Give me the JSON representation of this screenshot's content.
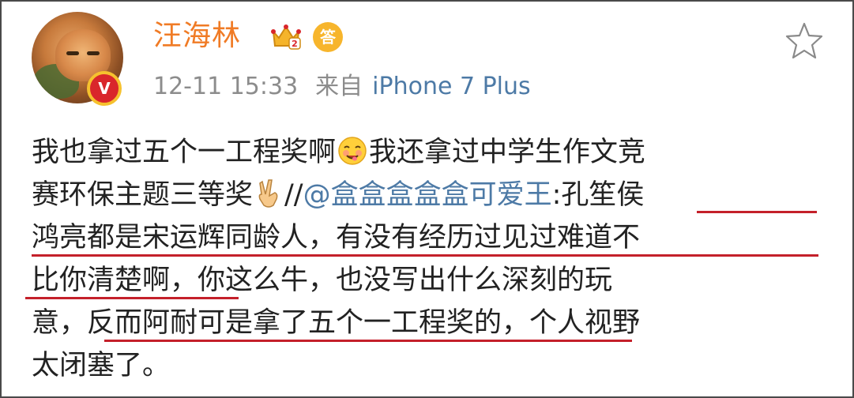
{
  "post": {
    "username": "汪海林",
    "verified_badge": "V",
    "answer_badge": "答",
    "timestamp": "12-11 15:33",
    "source_prefix": "来自",
    "source_device": "iPhone 7 Plus",
    "icons": {
      "avatar": "cat-avatar",
      "verified": "verified-v-icon",
      "member": "crown-member-icon",
      "answer": "answer-badge-icon",
      "favorite": "star-outline-icon"
    },
    "colors": {
      "username": "#f07b25",
      "meta": "#8c8c8c",
      "link": "#4d7aa6",
      "text": "#222222",
      "underline": "#c4202a"
    }
  },
  "body": {
    "l1_a": "我也拿过五个一工程奖啊",
    "l1_b": "我还拿过中学生作文竞",
    "l2_a": "赛环保主题三等奖",
    "l2_slash": "//",
    "l2_mention": "@盒盒盒盒盒可爱王",
    "l2_colon": ":",
    "l2_b": "孔笙侯",
    "l3": "鸿亮都是宋运辉同龄人，有没有经历过见过难道不",
    "l4": "比你清楚啊，你这么牛，也没写出什么深刻的玩",
    "l5": "意，反而阿耐可是拿了五个一工程奖的，个人视野",
    "l6": "太闭塞了。"
  }
}
